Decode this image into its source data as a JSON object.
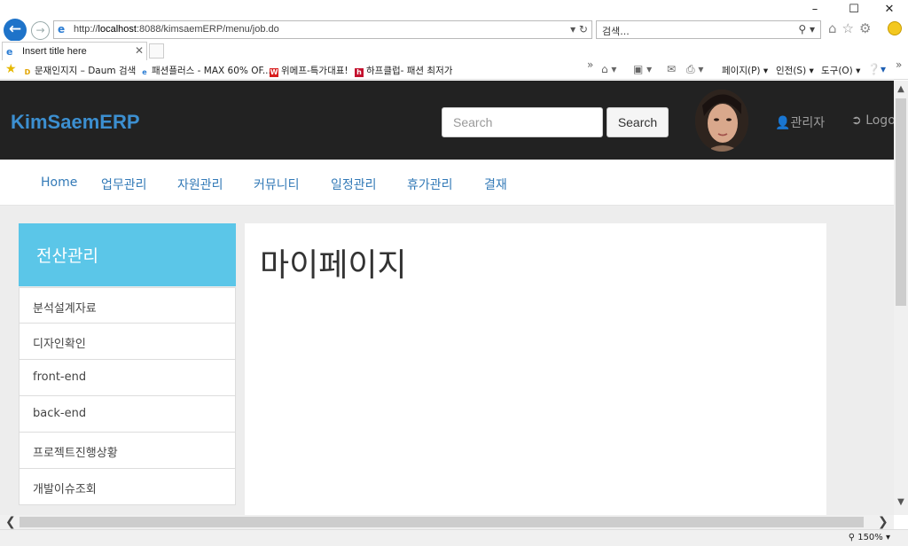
{
  "browser": {
    "url_prefix": "http://",
    "url_host": "localhost",
    "url_rest": ":8088/kimsaemERP/menu/job.do",
    "search_placeholder": "검색...",
    "tab_title": "Insert title here",
    "favorites": [
      {
        "label": "문재인지지 – Daum 검색",
        "icon_color": "#e2a400",
        "icon_char": "D"
      },
      {
        "label": "패션플러스 - MAX 60% OF...",
        "icon_color": "#2b7cd3",
        "icon_char": "e"
      },
      {
        "label": "위메프-특가대표!",
        "icon_color": "#d81e1e",
        "icon_char": "W"
      },
      {
        "label": "하프클럽- 패션 최저가",
        "icon_color": "#c4122f",
        "icon_char": "h"
      }
    ],
    "commands": {
      "page": "페이지(P)",
      "safety": "인전(S)",
      "tools": "도구(O)"
    },
    "zoom_level": "150%"
  },
  "header": {
    "brand": "KimSaemERP",
    "search_placeholder": "Search",
    "search_button": "Search",
    "user_label": "관리자",
    "logout_label": "Logout"
  },
  "menu": {
    "items": [
      "Home",
      "업무관리",
      "자원관리",
      "커뮤니티",
      "일정관리",
      "휴가관리",
      "결재"
    ]
  },
  "sidebar": {
    "title": "전산관리",
    "items": [
      "분석설계자료",
      "디자인확인",
      "front-end",
      "back-end",
      "프로젝트진행상황",
      "개발이슈조회"
    ]
  },
  "content": {
    "title": "마이페이지"
  },
  "colors": {
    "header_bg": "#222222",
    "brand": "#3c8fd0",
    "link": "#337ab7",
    "sidebar_head": "#5bc6e8"
  }
}
